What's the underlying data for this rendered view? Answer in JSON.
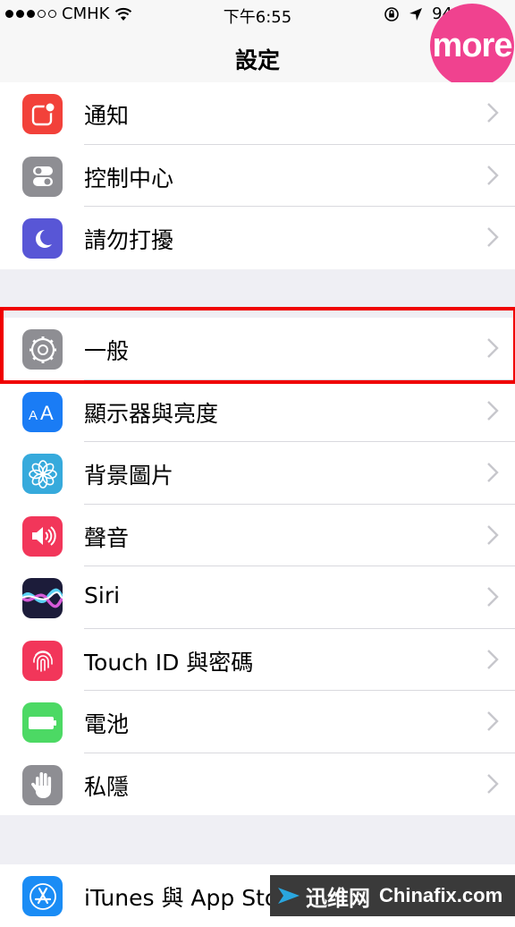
{
  "status_bar": {
    "carrier": "CMHK",
    "time": "下午6:55",
    "battery_text": "94"
  },
  "nav": {
    "title": "設定"
  },
  "badge": {
    "text": "more"
  },
  "groups": [
    {
      "items": [
        {
          "label": "通知",
          "icon": "notifications-icon",
          "color": "#f2413a"
        },
        {
          "label": "控制中心",
          "icon": "control-center-icon",
          "color": "#8e8e93"
        },
        {
          "label": "請勿打擾",
          "icon": "do-not-disturb-moon-icon",
          "color": "#5856d6"
        }
      ]
    },
    {
      "items": [
        {
          "label": "一般",
          "icon": "gear-icon",
          "color": "#8e8e93"
        },
        {
          "label": "顯示器與亮度",
          "icon": "display-aa-icon",
          "color": "#1a7cf5"
        },
        {
          "label": "背景圖片",
          "icon": "wallpaper-flower-icon",
          "color": "#36aadc"
        },
        {
          "label": "聲音",
          "icon": "speaker-icon",
          "color": "#f2365a"
        },
        {
          "label": "Siri",
          "icon": "siri-icon",
          "color": "#1c1c3a"
        },
        {
          "label": "Touch ID 與密碼",
          "icon": "fingerprint-icon",
          "color": "#f2365a"
        },
        {
          "label": "電池",
          "icon": "battery-icon",
          "color": "#4cd964"
        },
        {
          "label": "私隱",
          "icon": "hand-privacy-icon",
          "color": "#8e8e93"
        }
      ]
    },
    {
      "items": [
        {
          "label": "iTunes 與 App Store",
          "icon": "app-store-icon",
          "color": "#1a8cf5"
        }
      ]
    }
  ],
  "watermark": {
    "cn": "迅维网",
    "en": "Chinafix.com"
  }
}
